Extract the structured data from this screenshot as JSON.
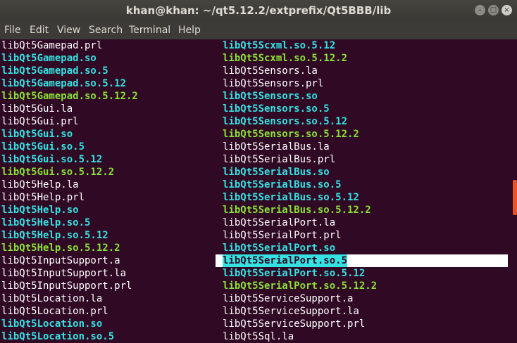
{
  "window": {
    "title": "khan@khan: ~/qt5.12.2/extprefix/Qt5BBB/lib",
    "btn_min": "–",
    "btn_max": "□",
    "btn_close": "×"
  },
  "menu": [
    "File",
    "Edit",
    "View",
    "Search",
    "Terminal",
    "Help"
  ],
  "colors": {
    "background": "#300a24",
    "plain_file": "#ffffff",
    "symlink": "#34e2e2",
    "regular_so": "#8ae234",
    "accent": "#e95420"
  },
  "columns": {
    "left": [
      {
        "text": "libQt5Gamepad.prl",
        "type": "plain"
      },
      {
        "text": "libQt5Gamepad.so",
        "type": "link"
      },
      {
        "text": "libQt5Gamepad.so.5",
        "type": "link"
      },
      {
        "text": "libQt5Gamepad.so.5.12",
        "type": "link"
      },
      {
        "text": "libQt5Gamepad.so.5.12.2",
        "type": "file"
      },
      {
        "text": "libQt5Gui.la",
        "type": "plain"
      },
      {
        "text": "libQt5Gui.prl",
        "type": "plain"
      },
      {
        "text": "libQt5Gui.so",
        "type": "link"
      },
      {
        "text": "libQt5Gui.so.5",
        "type": "link"
      },
      {
        "text": "libQt5Gui.so.5.12",
        "type": "link"
      },
      {
        "text": "libQt5Gui.so.5.12.2",
        "type": "file"
      },
      {
        "text": "libQt5Help.la",
        "type": "plain"
      },
      {
        "text": "libQt5Help.prl",
        "type": "plain"
      },
      {
        "text": "libQt5Help.so",
        "type": "link"
      },
      {
        "text": "libQt5Help.so.5",
        "type": "link"
      },
      {
        "text": "libQt5Help.so.5.12",
        "type": "link"
      },
      {
        "text": "libQt5Help.so.5.12.2",
        "type": "file"
      },
      {
        "text": "libQt5InputSupport.a",
        "type": "plain"
      },
      {
        "text": "libQt5InputSupport.la",
        "type": "plain"
      },
      {
        "text": "libQt5InputSupport.prl",
        "type": "plain"
      },
      {
        "text": "libQt5Location.la",
        "type": "plain"
      },
      {
        "text": "libQt5Location.prl",
        "type": "plain"
      },
      {
        "text": "libQt5Location.so",
        "type": "link"
      },
      {
        "text": "libQt5Location.so.5",
        "type": "link"
      }
    ],
    "right": [
      {
        "text": "libQt5Scxml.so.5.12",
        "type": "link"
      },
      {
        "text": "libQt5Scxml.so.5.12.2",
        "type": "file"
      },
      {
        "text": "libQt5Sensors.la",
        "type": "plain"
      },
      {
        "text": "libQt5Sensors.prl",
        "type": "plain"
      },
      {
        "text": "libQt5Sensors.so",
        "type": "link"
      },
      {
        "text": "libQt5Sensors.so.5",
        "type": "link"
      },
      {
        "text": "libQt5Sensors.so.5.12",
        "type": "link"
      },
      {
        "text": "libQt5Sensors.so.5.12.2",
        "type": "file"
      },
      {
        "text": "libQt5SerialBus.la",
        "type": "plain"
      },
      {
        "text": "libQt5SerialBus.prl",
        "type": "plain"
      },
      {
        "text": "libQt5SerialBus.so",
        "type": "link"
      },
      {
        "text": "libQt5SerialBus.so.5",
        "type": "link"
      },
      {
        "text": "libQt5SerialBus.so.5.12",
        "type": "link"
      },
      {
        "text": "libQt5SerialBus.so.5.12.2",
        "type": "file"
      },
      {
        "text": "libQt5SerialPort.la",
        "type": "plain"
      },
      {
        "text": "libQt5SerialPort.prl",
        "type": "plain"
      },
      {
        "text": "libQt5SerialPort.so",
        "type": "link"
      },
      {
        "text": "libQt5SerialPort.so.5",
        "type": "link",
        "selected": true
      },
      {
        "text": "libQt5SerialPort.so.5.12",
        "type": "link"
      },
      {
        "text": "libQt5SerialPort.so.5.12.2",
        "type": "file"
      },
      {
        "text": "libQt5ServiceSupport.a",
        "type": "plain"
      },
      {
        "text": "libQt5ServiceSupport.la",
        "type": "plain"
      },
      {
        "text": "libQt5ServiceSupport.prl",
        "type": "plain"
      },
      {
        "text": "libQt5Sql.la",
        "type": "plain"
      }
    ]
  }
}
